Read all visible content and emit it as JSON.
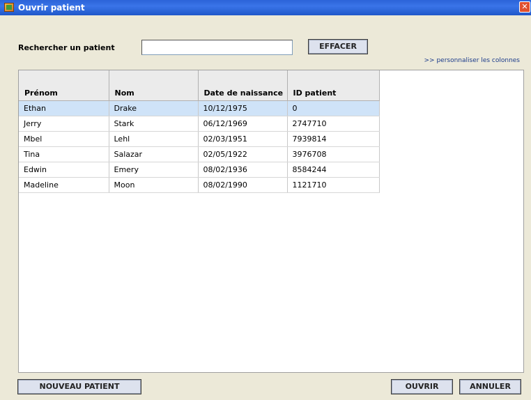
{
  "window": {
    "title": "Ouvrir patient",
    "close_label": "✕"
  },
  "search": {
    "label": "Rechercher un patient",
    "value": "",
    "placeholder": ""
  },
  "buttons": {
    "clear": "EFFACER",
    "new_patient": "NOUVEAU PATIENT",
    "open": "OUVRIR",
    "cancel": "ANNULER"
  },
  "customize_link": ">> personnaliser les colonnes",
  "table": {
    "headers": [
      "Prénom",
      "Nom",
      "Date de naissance",
      "ID patient"
    ],
    "rows": [
      [
        "Ethan",
        "Drake",
        "10/12/1975",
        "0"
      ],
      [
        "Jerry",
        "Stark",
        "06/12/1969",
        "2747710"
      ],
      [
        "Mbel",
        "Lehl",
        "02/03/1951",
        "7939814"
      ],
      [
        "Tina",
        "Salazar",
        "02/05/1922",
        "3976708"
      ],
      [
        "Edwin",
        "Emery",
        "08/02/1936",
        "8584244"
      ],
      [
        "Madeline",
        "Moon",
        "08/02/1990",
        "1121710"
      ]
    ],
    "selected_row": 0
  },
  "colors": {
    "titlebar": "#2b63d8",
    "selection": "#cfe3f8",
    "background": "#ece9d8"
  }
}
